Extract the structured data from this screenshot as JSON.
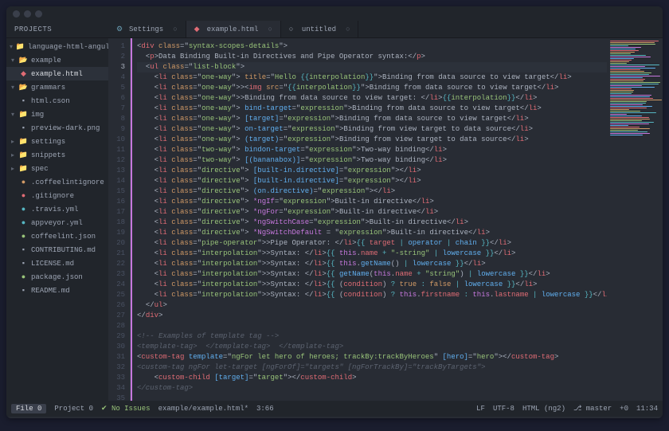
{
  "window": {
    "projects_label": "PROJECTS"
  },
  "tabs": [
    {
      "icon": "cog",
      "label": "Settings"
    },
    {
      "icon": "html",
      "label": "example.html",
      "active": true
    },
    {
      "icon": "file",
      "label": "untitled"
    }
  ],
  "sidebar": [
    {
      "d": 0,
      "chev": "down",
      "ico": "folder",
      "label": "language-html-angular"
    },
    {
      "d": 1,
      "chev": "down",
      "ico": "ofold",
      "label": "example"
    },
    {
      "d": 2,
      "ico": "html",
      "label": "example.html",
      "sel": true
    },
    {
      "d": 1,
      "chev": "down",
      "ico": "ofold",
      "label": "grammars"
    },
    {
      "d": 2,
      "ico": "file",
      "label": "html.cson"
    },
    {
      "d": 1,
      "chev": "down",
      "ico": "folder",
      "label": "img"
    },
    {
      "d": 2,
      "ico": "file",
      "label": "preview-dark.png"
    },
    {
      "d": 1,
      "chev": "right",
      "ico": "folder",
      "label": "settings"
    },
    {
      "d": 1,
      "chev": "right",
      "ico": "folder",
      "label": "snippets"
    },
    {
      "d": 1,
      "chev": "right",
      "ico": "folder",
      "label": "spec"
    },
    {
      "d": 1,
      "ico": "orange",
      "label": ".coffeelintignore"
    },
    {
      "d": 1,
      "ico": "red",
      "label": ".gitignore"
    },
    {
      "d": 1,
      "ico": "cyan",
      "label": ".travis.yml"
    },
    {
      "d": 1,
      "ico": "cyan",
      "label": "appveyor.yml"
    },
    {
      "d": 1,
      "ico": "green",
      "label": "coffeelint.json"
    },
    {
      "d": 1,
      "ico": "file",
      "label": "CONTRIBUTING.md"
    },
    {
      "d": 1,
      "ico": "file",
      "label": "LICENSE.md"
    },
    {
      "d": 1,
      "ico": "green",
      "label": "package.json"
    },
    {
      "d": 1,
      "ico": "file",
      "label": "README.md"
    }
  ],
  "lines": 35,
  "current_line": 3,
  "status": {
    "file": "File 0",
    "project": "Project 0",
    "issues": "No Issues",
    "path": "example/example.html*",
    "cursor": "3:66",
    "lf": "LF",
    "enc": "UTF-8",
    "lang": "HTML (ng2)",
    "branch": "master",
    "diff": "+0",
    "time": "11:34"
  }
}
